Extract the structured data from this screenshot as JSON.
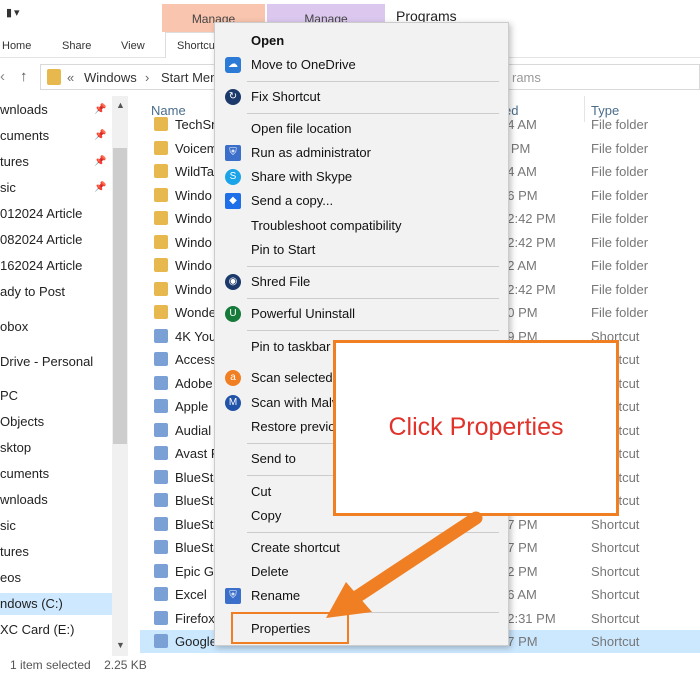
{
  "window": {
    "title": "Programs"
  },
  "ribbon": {
    "tabs": [
      "Home",
      "Share",
      "View",
      "Shortcu"
    ],
    "context_tabs": [
      "Manage",
      "Manage"
    ]
  },
  "address": {
    "crumbs": [
      "«",
      "Windows",
      "›",
      "Start Men"
    ],
    "right_text": "rams"
  },
  "navpane": {
    "items": [
      "wnloads",
      "cuments",
      "tures",
      "sic",
      "012024 Article",
      "082024 Article",
      "162024 Article",
      "ady to Post",
      "obox",
      "Drive - Personal",
      "PC",
      "Objects",
      "sktop",
      "cuments",
      "wnloads",
      "sic",
      "tures",
      "eos",
      "ndows (C:)",
      "XC Card (E:)"
    ]
  },
  "columns": {
    "name": "Name",
    "date": "ed",
    "type": "Type"
  },
  "files": [
    {
      "name": "TechSn",
      "date": "54 AM",
      "type": "File folder",
      "kind": "folder"
    },
    {
      "name": "Voicem",
      "date": "2 PM",
      "type": "File folder",
      "kind": "folder"
    },
    {
      "name": "WildTa",
      "date": "54 AM",
      "type": "File folder",
      "kind": "folder"
    },
    {
      "name": "Windo",
      "date": "46 PM",
      "type": "File folder",
      "kind": "folder"
    },
    {
      "name": "Windo",
      "date": "12:42 PM",
      "type": "File folder",
      "kind": "folder"
    },
    {
      "name": "Windo",
      "date": "12:42 PM",
      "type": "File folder",
      "kind": "folder"
    },
    {
      "name": "Windo",
      "date": "52 AM",
      "type": "File folder",
      "kind": "folder"
    },
    {
      "name": "Windo",
      "date": "12:42 PM",
      "type": "File folder",
      "kind": "folder"
    },
    {
      "name": "Wonde",
      "date": "20 PM",
      "type": "File folder",
      "kind": "folder"
    },
    {
      "name": "4K You",
      "date": "19 PM",
      "type": "Shortcut",
      "kind": "shortcut"
    },
    {
      "name": "Access",
      "date": "",
      "type": "Shortcut",
      "kind": "shortcut"
    },
    {
      "name": "Adobe",
      "date": "",
      "type": "Shortcut",
      "kind": "shortcut"
    },
    {
      "name": "Apple",
      "date": "",
      "type": "Shortcut",
      "kind": "shortcut"
    },
    {
      "name": "Audial",
      "date": "",
      "type": "Shortcut",
      "kind": "shortcut"
    },
    {
      "name": "Avast F",
      "date": "",
      "type": "Shortcut",
      "kind": "shortcut"
    },
    {
      "name": "BlueSta",
      "date": "",
      "type": "Shortcut",
      "kind": "shortcut"
    },
    {
      "name": "BlueSta",
      "date": "",
      "type": "Shortcut",
      "kind": "shortcut"
    },
    {
      "name": "BlueSta",
      "date": "57 PM",
      "type": "Shortcut",
      "kind": "shortcut"
    },
    {
      "name": "BlueSta",
      "date": "57 PM",
      "type": "Shortcut",
      "kind": "shortcut"
    },
    {
      "name": "Epic Ga",
      "date": "32 PM",
      "type": "Shortcut",
      "kind": "shortcut"
    },
    {
      "name": "Excel",
      "date": "36 AM",
      "type": "Shortcut",
      "kind": "shortcut"
    },
    {
      "name": "Firefox",
      "date": "12:31 PM",
      "type": "Shortcut",
      "kind": "shortcut"
    },
    {
      "name": "Google",
      "date": "07 PM",
      "type": "Shortcut",
      "kind": "shortcut"
    }
  ],
  "status": {
    "selected": "1 item selected",
    "size": "2.25 KB"
  },
  "menu": {
    "items": [
      "Open",
      "Move to OneDrive",
      "Fix Shortcut",
      "Open file location",
      "Run as administrator",
      "Share with Skype",
      "Send a copy...",
      "Troubleshoot compatibility",
      "Pin to Start",
      "Shred File",
      "Powerful Uninstall",
      "Pin to taskbar",
      "Scan selected",
      "Scan with Malv",
      "Restore previo",
      "Send to",
      "Cut",
      "Copy",
      "Create shortcut",
      "Delete",
      "Rename",
      "Properties"
    ]
  },
  "callout": {
    "text": "Click Properties"
  },
  "colors": {
    "accent": "#f07f23",
    "callout_text": "#e0332b",
    "selection": "#cce8ff"
  }
}
